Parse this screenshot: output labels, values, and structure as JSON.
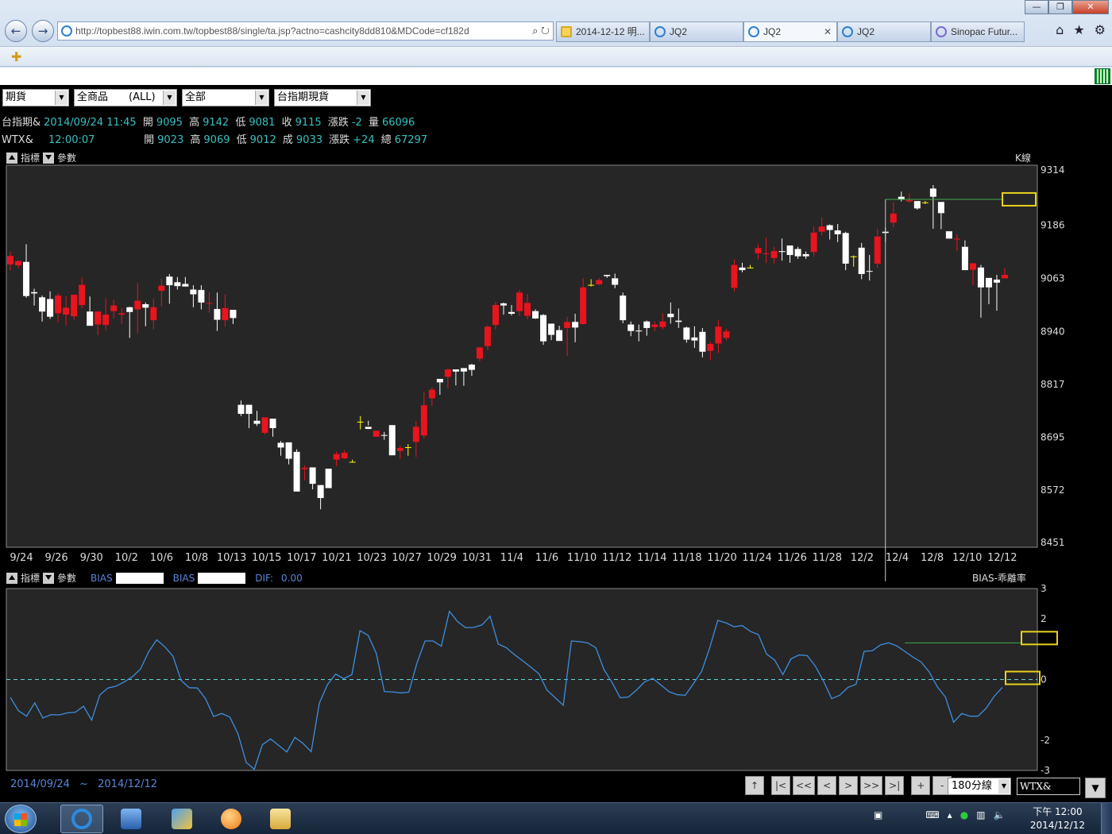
{
  "browser": {
    "address_url": "http://topbest88.iwin.com.tw/topbest88/single/ta.jsp?actno=cashcity8dd810&MDCode=cf182d",
    "tabs": [
      {
        "label": "2014-12-12 明...",
        "active": false
      },
      {
        "label": "JQ2",
        "active": false
      },
      {
        "label": "JQ2",
        "active": true,
        "close": "✕"
      },
      {
        "label": "JQ2",
        "active": false
      },
      {
        "label": "Sinopac Futur...",
        "active": false
      }
    ]
  },
  "toolbar": {
    "selects": [
      "期貨",
      "全商品　　(ALL)",
      "全部",
      "台指期現貨"
    ]
  },
  "quote1": {
    "name": "台指期&",
    "time": "2014/09/24 11:45",
    "open_label": "開",
    "open": "9095",
    "high_label": "高",
    "high": "9142",
    "low_label": "低",
    "low": "9081",
    "close_label": "收",
    "close": "9115",
    "change_label": "漲跌",
    "change": "-2",
    "vol_label": "量",
    "vol": "66096"
  },
  "quote2": {
    "name": "WTX&",
    "time": "12:00:07",
    "open_label": "開",
    "open": "9023",
    "high_label": "高",
    "high": "9069",
    "low_label": "低",
    "low": "9012",
    "close_label": "成",
    "close": "9033",
    "change_label": "漲跌",
    "change": "+24",
    "vol_label": "總",
    "vol": "67297"
  },
  "panel1": {
    "indicator_label": "指標",
    "params_label": "參數",
    "title": "K線"
  },
  "panel2": {
    "indicator_label": "指標",
    "params_label": "參數",
    "bias1_label": "BIAS",
    "bias2_label": "BIAS",
    "dif_label": "DIF:",
    "dif_value": "0.00",
    "title": "BIAS-乖離率"
  },
  "range": {
    "start": "2014/09/24",
    "sep": "~",
    "end": "2014/12/12"
  },
  "controls": {
    "buttons": [
      "↑",
      "|<",
      "<<",
      "<",
      ">",
      ">>",
      ">|",
      "+",
      "-"
    ],
    "period": "180分線",
    "symbol": "WTX&",
    "drop": "▼"
  },
  "taskbar": {
    "clock_time": "下午 12:00",
    "clock_date": "2014/12/12"
  },
  "colors": {
    "up": "#e8141e",
    "down": "#ffffff",
    "doji": "#ffff00",
    "bias_line": "#3d8fe0",
    "zero_line": "#5fd6d6",
    "background": "#262626"
  },
  "chart_data": [
    {
      "type": "candlestick",
      "title": "K線",
      "ylim": [
        8451,
        9314
      ],
      "y_ticks": [
        9314,
        9186,
        9063,
        8940,
        8817,
        8695,
        8572,
        8451
      ],
      "x_tick_labels": [
        "9/24",
        "9/26",
        "9/30",
        "10/2",
        "10/6",
        "10/8",
        "10/13",
        "10/15",
        "10/17",
        "10/21",
        "10/23",
        "10/27",
        "10/29",
        "10/31",
        "11/4",
        "11/6",
        "11/10",
        "11/12",
        "11/14",
        "11/18",
        "11/20",
        "11/24",
        "11/26",
        "11/28",
        "12/2",
        "12/4",
        "12/8",
        "12/10",
        "12/12"
      ],
      "candles": [
        [
          9095,
          9115,
          9125,
          9081
        ],
        [
          9093,
          9103,
          9105,
          9086
        ],
        [
          9101,
          9022,
          9142,
          9018
        ],
        [
          9031,
          9028,
          9039,
          9000
        ],
        [
          9019,
          8986,
          9023,
          8963
        ],
        [
          9015,
          8974,
          9033,
          8969
        ],
        [
          8982,
          9023,
          9029,
          8961
        ],
        [
          8979,
          8995,
          9021,
          8953
        ],
        [
          8975,
          9025,
          9024,
          8967
        ],
        [
          9001,
          9048,
          9065,
          8994
        ],
        [
          8986,
          8953,
          9021,
          8956
        ],
        [
          8956,
          8986,
          8980,
          8931
        ],
        [
          8955,
          8979,
          9017,
          8943
        ],
        [
          8987,
          9000,
          9014,
          8970
        ],
        [
          8979,
          8982,
          8994,
          8958
        ],
        [
          8996,
          8985,
          8997,
          8925
        ],
        [
          8991,
          9011,
          9052,
          8935
        ],
        [
          9003,
          8995,
          9007,
          8952
        ],
        [
          8966,
          8996,
          9016,
          8945
        ],
        [
          9034,
          9046,
          9062,
          8998
        ],
        [
          9067,
          9047,
          9073,
          9004
        ],
        [
          9054,
          9045,
          9066,
          9037
        ],
        [
          9050,
          9044,
          9066,
          9049
        ],
        [
          9037,
          9026,
          9047,
          8996
        ],
        [
          9036,
          9007,
          9047,
          8991
        ],
        [
          9005,
          9006,
          9031,
          8983
        ],
        [
          8992,
          8967,
          9030,
          8941
        ],
        [
          8966,
          8994,
          9026,
          8951
        ],
        [
          8990,
          8971,
          8978,
          8957
        ],
        [
          8770,
          8749,
          8780,
          8744
        ],
        [
          8770,
          8749,
          8769,
          8716
        ],
        [
          8733,
          8726,
          8756,
          8721
        ],
        [
          8705,
          8741,
          8739,
          8701
        ],
        [
          8738,
          8716,
          8735,
          8696
        ],
        [
          8682,
          8671,
          8686,
          8652
        ],
        [
          8683,
          8645,
          8665,
          8632
        ],
        [
          8661,
          8569,
          8667,
          8598
        ],
        [
          8621,
          8624,
          8630,
          8595
        ],
        [
          8625,
          8587,
          8595,
          8574
        ],
        [
          8584,
          8554,
          8584,
          8528
        ],
        [
          8622,
          8577,
          8622,
          8612
        ],
        [
          8643,
          8656,
          8662,
          8628
        ],
        [
          8646,
          8659,
          8665,
          8644
        ],
        [
          8637,
          8637,
          8636,
          8643
        ],
        [
          8730,
          8730,
          8744,
          8713
        ],
        [
          8719,
          8714,
          8733,
          8722
        ],
        [
          8696,
          8710,
          8708,
          8701
        ],
        [
          8700,
          8699,
          8707,
          8689
        ],
        [
          8723,
          8653,
          8722,
          8659
        ],
        [
          8663,
          8670,
          8676,
          8645
        ],
        [
          8671,
          8671,
          8679,
          8652
        ],
        [
          8684,
          8719,
          8732,
          8649
        ],
        [
          8699,
          8769,
          8800,
          8692
        ],
        [
          8785,
          8805,
          8810,
          8767
        ],
        [
          8830,
          8822,
          8828,
          8793
        ],
        [
          8835,
          8852,
          8854,
          8808
        ],
        [
          8852,
          8847,
          8851,
          8815
        ],
        [
          8855,
          8847,
          8855,
          8814
        ],
        [
          8863,
          8851,
          8865,
          8837
        ],
        [
          8877,
          8903,
          8903,
          8870
        ],
        [
          8906,
          8951,
          8954,
          8896
        ],
        [
          8955,
          9001,
          9008,
          8945
        ],
        [
          9005,
          9000,
          9007,
          8979
        ],
        [
          8985,
          8981,
          9001,
          8977
        ],
        [
          8987,
          9030,
          9036,
          8976
        ],
        [
          8976,
          9006,
          9027,
          8968
        ],
        [
          8987,
          8970,
          8991,
          8969
        ],
        [
          8978,
          8917,
          8980,
          8909
        ],
        [
          8958,
          8932,
          8955,
          8920
        ],
        [
          8943,
          8918,
          8953,
          8920
        ],
        [
          8948,
          8962,
          8974,
          8883
        ],
        [
          8962,
          8949,
          8981,
          8915
        ],
        [
          8957,
          9042,
          9063,
          8956
        ],
        [
          9047,
          9047,
          9061,
          9044
        ],
        [
          9049,
          9059,
          9064,
          9047
        ],
        [
          9071,
          9068,
          9071,
          9064
        ],
        [
          9063,
          9048,
          9074,
          9040
        ],
        [
          9023,
          8966,
          9030,
          8959
        ],
        [
          8956,
          8941,
          8963,
          8929
        ],
        [
          8942,
          8940,
          8956,
          8917
        ],
        [
          8963,
          8948,
          8965,
          8930
        ],
        [
          8950,
          8956,
          8963,
          8941
        ],
        [
          8950,
          8963,
          8982,
          8944
        ],
        [
          8981,
          8973,
          9007,
          8958
        ],
        [
          8965,
          8962,
          8993,
          8948
        ],
        [
          8949,
          8921,
          8951,
          8914
        ],
        [
          8926,
          8919,
          8952,
          8902
        ],
        [
          8939,
          8893,
          8948,
          8880
        ],
        [
          8895,
          8911,
          8916,
          8873
        ],
        [
          8912,
          8951,
          8966,
          8890
        ],
        [
          8925,
          8940,
          8946,
          8919
        ],
        [
          9041,
          9094,
          9107,
          9032
        ],
        [
          9088,
          9082,
          9099,
          9077
        ],
        [
          9087,
          9087,
          9094,
          9086
        ],
        [
          9121,
          9133,
          9142,
          9107
        ],
        [
          9120,
          9121,
          9157,
          9098
        ],
        [
          9110,
          9126,
          9136,
          9097
        ],
        [
          9126,
          9124,
          9155,
          9104
        ],
        [
          9139,
          9117,
          9139,
          9099
        ],
        [
          9131,
          9114,
          9136,
          9108
        ],
        [
          9119,
          9114,
          9125,
          9108
        ],
        [
          9124,
          9169,
          9183,
          9113
        ],
        [
          9171,
          9183,
          9204,
          9162
        ],
        [
          9186,
          9175,
          9188,
          9153
        ],
        [
          9174,
          9165,
          9189,
          9147
        ],
        [
          9168,
          9097,
          9171,
          9082
        ],
        [
          9113,
          9113,
          9116,
          9090
        ],
        [
          9134,
          9073,
          9145,
          9061
        ],
        [
          9080,
          9079,
          9117,
          9058
        ],
        [
          9097,
          9160,
          9178,
          9087
        ],
        [
          9171,
          9168,
          9181,
          9147
        ],
        [
          9192,
          9213,
          9240,
          9181
        ],
        [
          9252,
          9246,
          9264,
          9241
        ],
        [
          9241,
          9244,
          9260,
          9238
        ],
        [
          9242,
          9225,
          9239,
          9222
        ],
        [
          9238,
          9238,
          9242,
          9235
        ],
        [
          9271,
          9252,
          9279,
          9178
        ],
        [
          9240,
          9214,
          9239,
          9177
        ],
        [
          9172,
          9155,
          9162,
          9159
        ],
        [
          9154,
          9155,
          9165,
          9126
        ],
        [
          9136,
          9082,
          9151,
          9082
        ],
        [
          9083,
          9098,
          9092,
          9047
        ],
        [
          9088,
          9042,
          9094,
          8972
        ],
        [
          9064,
          9042,
          9062,
          9003
        ],
        [
          9060,
          9053,
          9071,
          8988
        ],
        [
          9063,
          9071,
          9087,
          9063
        ]
      ],
      "annotations": {
        "crosshair_value": 9246
      }
    },
    {
      "type": "line",
      "title": "BIAS-乖離率",
      "ylim": [
        -3,
        3
      ],
      "y_ticks": [
        3,
        2,
        0,
        -2,
        -3
      ],
      "series": [
        {
          "name": "BIAS",
          "values": [
            -0.59,
            -1.03,
            -1.21,
            -0.77,
            -1.27,
            -1.16,
            -1.17,
            -1.1,
            -1.08,
            -0.88,
            -1.34,
            -0.51,
            -0.28,
            -0.22,
            -0.08,
            0.09,
            0.34,
            0.91,
            1.31,
            1.08,
            0.77,
            -0.03,
            -0.27,
            -0.28,
            -0.63,
            -1.22,
            -1.12,
            -1.24,
            -1.79,
            -2.73,
            -2.96,
            -2.15,
            -1.96,
            -2.17,
            -2.39,
            -1.91,
            -2.11,
            -2.38,
            -0.78,
            -0.17,
            0.18,
            0.03,
            0.16,
            1.61,
            1.46,
            0.87,
            -0.4,
            -0.41,
            -0.44,
            -0.42,
            0.54,
            1.27,
            1.27,
            1.1,
            2.25,
            1.91,
            1.71,
            1.72,
            1.8,
            2.09,
            1.17,
            1.05,
            0.82,
            0.62,
            0.41,
            0.19,
            -0.35,
            -0.6,
            -0.85,
            1.27,
            1.25,
            1.21,
            1.05,
            0.33,
            -0.1,
            -0.6,
            -0.58,
            -0.35,
            -0.08,
            0.04,
            -0.18,
            -0.4,
            -0.5,
            -0.52,
            -0.14,
            0.26,
            1.04,
            1.95,
            1.87,
            1.74,
            1.78,
            1.59,
            1.48,
            0.84,
            0.64,
            0.16,
            0.68,
            0.81,
            0.79,
            0.44,
            -0.05,
            -0.63,
            -0.52,
            -0.26,
            -0.16,
            0.93,
            0.95,
            1.14,
            1.21,
            1.11,
            0.93,
            0.74,
            0.58,
            0.25,
            -0.24,
            -0.58,
            -1.41,
            -1.12,
            -1.21,
            -1.21,
            -0.95,
            -0.55,
            -0.26
          ]
        }
      ],
      "reference_line": 0,
      "annotations": {
        "crosshair_value": 1.21
      }
    }
  ]
}
